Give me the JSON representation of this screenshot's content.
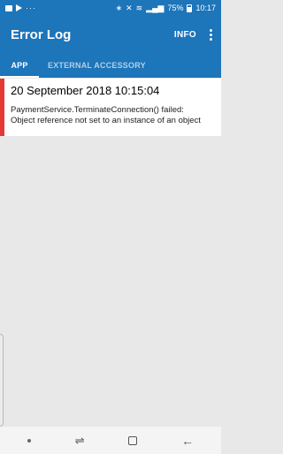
{
  "status_bar": {
    "battery": "75%",
    "time": "10:17"
  },
  "app_bar": {
    "title": "Error Log",
    "info_label": "INFO"
  },
  "tabs": [
    {
      "label": "APP",
      "active": true
    },
    {
      "label": "EXTERNAL ACCESSORY",
      "active": false
    }
  ],
  "entries": [
    {
      "timestamp": "20 September 2018 10:15:04",
      "message_line1": "PaymentService.TerminateConnection() failed:",
      "message_line2": " Object reference not set to an instance of an object",
      "accent_color": "#e53935"
    }
  ],
  "colors": {
    "primary": "#1d75ba",
    "background": "#e8e8e8"
  },
  "nav_bar": {
    "recent_icon": "recent-apps-icon",
    "home_icon": "home-icon",
    "back_icon": "back-arrow-icon"
  }
}
